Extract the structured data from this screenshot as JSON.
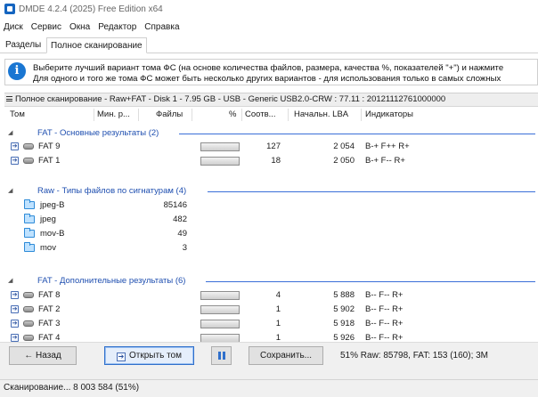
{
  "window": {
    "title": "DMDE 4.2.4 (2025) Free Edition x64"
  },
  "menu": [
    "Диск",
    "Сервис",
    "Окна",
    "Редактор",
    "Справка"
  ],
  "tabs": [
    "Разделы",
    "Полное сканирование"
  ],
  "info": {
    "line1": "Выберите лучший вариант тома ФС (на основе количества файлов, размера, качества %, показателей \"+\") и нажмите",
    "line2": "Для одного и того же тома ФС может быть несколько других вариантов - для использования только в самых сложных"
  },
  "panel_title": "Полное сканирование - Raw+FAT - Disk 1 - 7.95 GB - USB - Generic USB2.0-CRW : 77.11 : 20121112761000000",
  "columns": [
    "Том",
    "Мин. р...",
    "Файлы",
    "%",
    "Соотв...",
    "Начальн. LBA",
    "Индикаторы"
  ],
  "groups": {
    "fat_main": {
      "toggle": "◢",
      "label": "FAT - Основные результаты (2)"
    },
    "raw": {
      "toggle": "◢",
      "label": "Raw - Типы файлов по сигнатурам (4)"
    },
    "fat_extra": {
      "toggle": "◢",
      "label": "FAT - Дополнительные результаты (6)"
    }
  },
  "fat_main_rows": [
    {
      "name": "FAT 9",
      "match": "127",
      "lba": "2 054",
      "ind": "B-+ F++ R+"
    },
    {
      "name": "FAT 1",
      "match": "18",
      "lba": "2 050",
      "ind": "B-+ F-- R+"
    }
  ],
  "raw_rows": [
    {
      "name": "jpeg-B",
      "files": "85146"
    },
    {
      "name": "jpeg",
      "files": "482"
    },
    {
      "name": "mov-B",
      "files": "49"
    },
    {
      "name": "mov",
      "files": "3"
    }
  ],
  "fat_extra_rows": [
    {
      "name": "FAT 8",
      "match": "4",
      "lba": "5 888",
      "ind": "B-- F-- R+"
    },
    {
      "name": "FAT 2",
      "match": "1",
      "lba": "5 902",
      "ind": "B-- F-- R+"
    },
    {
      "name": "FAT 3",
      "match": "1",
      "lba": "5 918",
      "ind": "B-- F-- R+"
    },
    {
      "name": "FAT 4",
      "match": "1",
      "lba": "5 926",
      "ind": "B-- F-- R+"
    }
  ],
  "buttons": {
    "back": "← Назад",
    "open": "Открыть том",
    "save": "Сохранить..."
  },
  "icons": {
    "open": "arrow-right-icon",
    "pause": "pause-icon"
  },
  "stats": "51% Raw: 85798, FAT: 153 (160); 3M",
  "status": "Сканирование... 8 003 584 (51%)",
  "colors": {
    "accent": "#1976d2",
    "group_text": "#1f4fb0",
    "group_line": "#3a6fd8"
  }
}
